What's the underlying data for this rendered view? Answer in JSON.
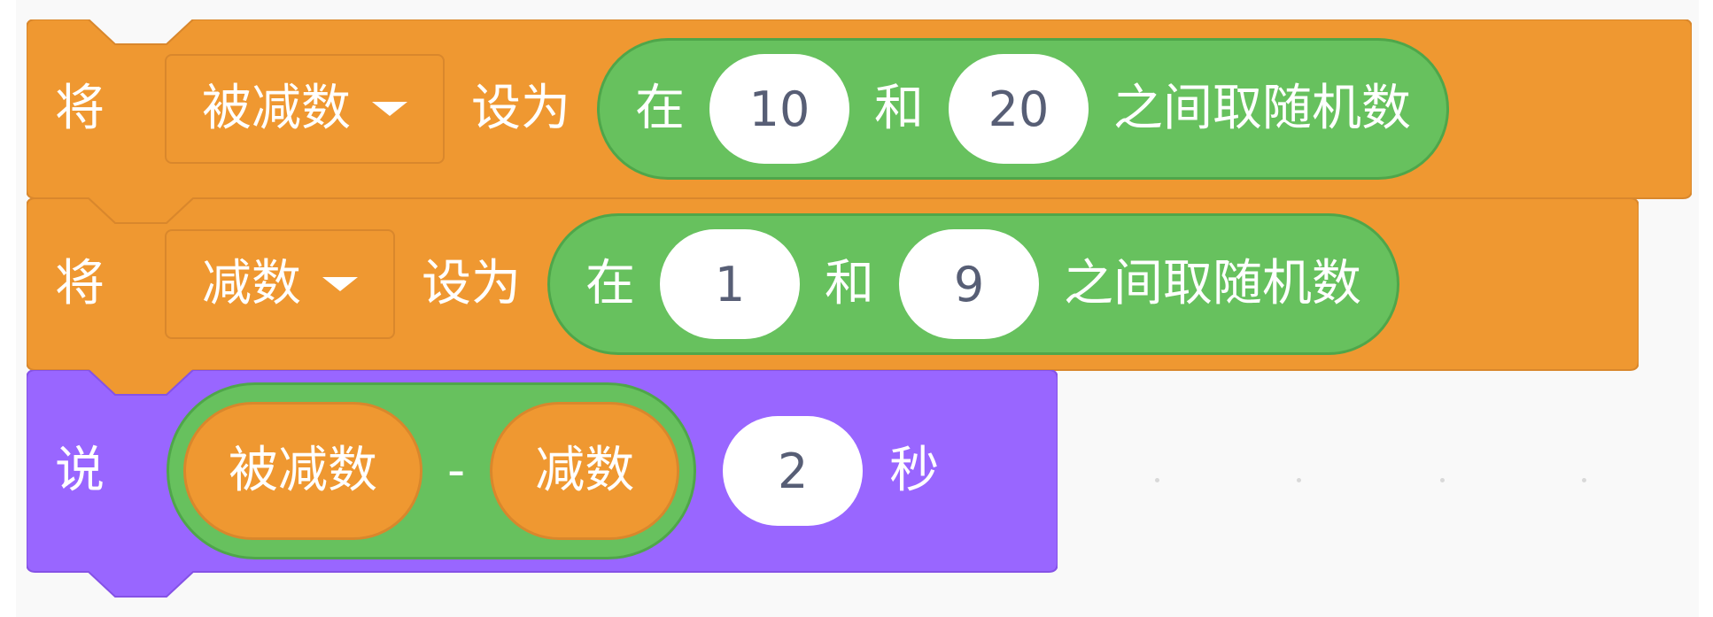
{
  "blocks": [
    {
      "type": "set_variable",
      "label": "将",
      "variable": "被减数",
      "connector": "设为",
      "reporter": {
        "label_before": "在",
        "from": "10",
        "and": "和",
        "to": "20",
        "label_after": "之间取随机数"
      }
    },
    {
      "type": "set_variable",
      "label": "将",
      "variable": "减数",
      "connector": "设为",
      "reporter": {
        "label_before": "在",
        "from": "1",
        "and": "和",
        "to": "9",
        "label_after": "之间取随机数"
      }
    },
    {
      "type": "say_for_secs",
      "label": "说",
      "operator": {
        "left": "被减数",
        "symbol": "-",
        "right": "减数"
      },
      "seconds": "2",
      "unit": "秒"
    }
  ],
  "colors": {
    "variables": "#ef9831",
    "operators": "#67c15e",
    "looks": "#9966ff",
    "workspace": "#f9f9f9"
  }
}
